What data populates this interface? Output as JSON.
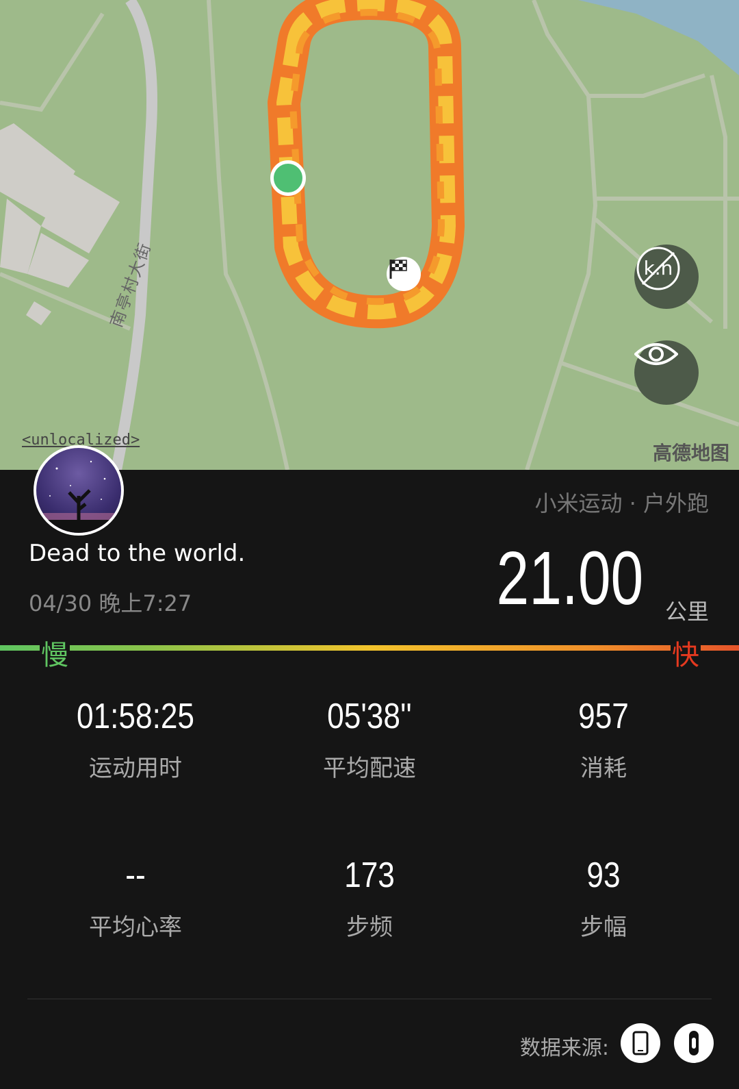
{
  "map": {
    "street_label": "南亭村大街",
    "unlocalized_label": "<unlocalized>",
    "provider_logo": "高德地图",
    "icons": [
      "km-toggle-icon",
      "eye-icon",
      "start-marker-icon",
      "finish-flag-icon"
    ]
  },
  "profile": {
    "tagline": "Dead to the world.",
    "datetime": "04/30 晚上7:27",
    "source": "小米运动 · 户外跑"
  },
  "summary": {
    "distance": "21.00",
    "unit": "公里"
  },
  "speed_legend": {
    "slow": "慢",
    "fast": "快"
  },
  "stats": [
    {
      "value": "01:58:25",
      "label": "运动用时"
    },
    {
      "value": "05'38''",
      "label": "平均配速"
    },
    {
      "value": "957",
      "label": "消耗"
    },
    {
      "value": "--",
      "label": "平均心率"
    },
    {
      "value": "173",
      "label": "步频"
    },
    {
      "value": "93",
      "label": "步幅"
    }
  ],
  "footer": {
    "data_source_label": "数据来源:",
    "icons": [
      "phone-icon",
      "band-icon"
    ]
  },
  "colors": {
    "background": "#151515",
    "map_green": "#9eba8a",
    "track_orange": "#f07a2a",
    "track_yellow": "#f7c23a",
    "slow_green": "#5fc561",
    "fast_red": "#e5391f"
  }
}
